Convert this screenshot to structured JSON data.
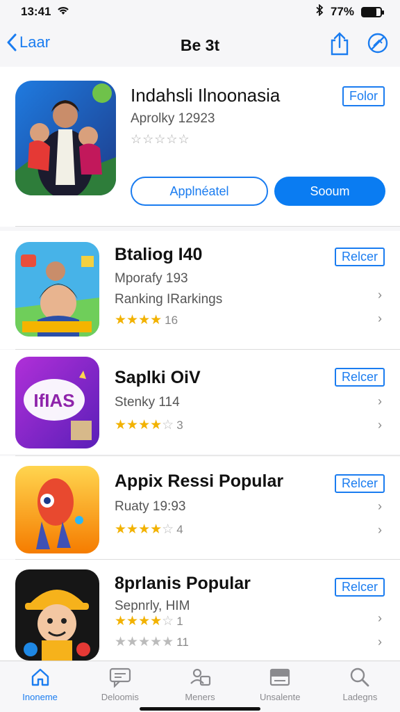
{
  "status": {
    "time": "13:41",
    "battery": "77%",
    "battery_level": 0.77
  },
  "nav": {
    "back_label": "Laar",
    "title": "Be 3t"
  },
  "featured": {
    "title": "Indahsli Ilnoonasia",
    "subtitle": "Aprolky 12923",
    "stars": "☆☆☆☆☆",
    "follow_label": "Folor",
    "button_outline": "Applnéatel",
    "button_solid": "Sooum"
  },
  "items": [
    {
      "title": "Btaliog I40",
      "line1": "Mporafy 193",
      "line2": "Ranking IRarkings",
      "stars_on": "★★★★",
      "stars_off": "",
      "count": "16",
      "button": "Relcer"
    },
    {
      "title": "Saplki OiV",
      "line1": "Stenky 114",
      "line2": "",
      "stars_on": "★★★★",
      "stars_off": "☆",
      "count": "3",
      "button": "Relcer"
    },
    {
      "title": "Appix Ressi Popular",
      "line1": "Ruaty 19:93",
      "line2": "",
      "stars_on": "★★★★",
      "stars_off": "☆",
      "count": "4",
      "button": "Relcer"
    },
    {
      "title": "8prlanis Popular",
      "line1": "Sepnrly, HIM",
      "line2": "",
      "stars_on": "★★★★",
      "stars_off": "☆",
      "count": "1",
      "stars2": "★★★★★",
      "count2": "11",
      "button": "Relcer"
    }
  ],
  "tabs": [
    {
      "label": "Inoneme",
      "icon": "home-icon",
      "active": true
    },
    {
      "label": "Deloomis",
      "icon": "chat-icon",
      "active": false
    },
    {
      "label": "Meners",
      "icon": "people-icon",
      "active": false
    },
    {
      "label": "Unsalente",
      "icon": "tray-icon",
      "active": false
    },
    {
      "label": "Ladegns",
      "icon": "search-icon",
      "active": false
    }
  ],
  "colors": {
    "accent": "#1a7cf0",
    "star": "#f2b200"
  }
}
